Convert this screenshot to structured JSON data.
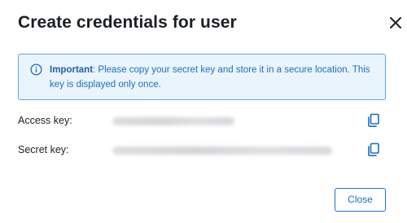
{
  "dialog": {
    "title": "Create credentials for user",
    "close_icon": "close-icon"
  },
  "alert": {
    "icon": "info-icon",
    "strong": "Important",
    "message": ": Please copy your secret key and store it in a secure location. This key is displayed only once.",
    "accent_color": "#1f6fb8",
    "background_color": "#eaf4fd"
  },
  "fields": [
    {
      "label": "Access key:",
      "copy_icon": "copy-icon"
    },
    {
      "label": "Secret key:",
      "copy_icon": "copy-icon"
    }
  ],
  "footer": {
    "close_label": "Close"
  }
}
